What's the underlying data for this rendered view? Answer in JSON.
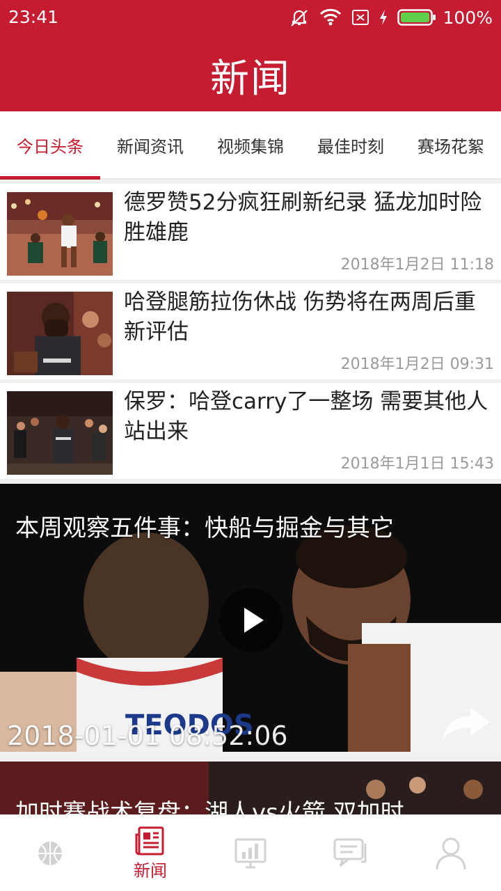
{
  "status_bar": {
    "time": "23:41",
    "battery": "100%",
    "icons": [
      "mute-icon",
      "wifi-icon",
      "sim-off-icon",
      "charging-icon",
      "battery-icon"
    ]
  },
  "header": {
    "title": "新闻"
  },
  "tabs": [
    {
      "label": "今日头条",
      "active": true
    },
    {
      "label": "新闻资讯",
      "active": false
    },
    {
      "label": "视频集锦",
      "active": false
    },
    {
      "label": "最佳时刻",
      "active": false
    },
    {
      "label": "赛场花絮",
      "active": false
    }
  ],
  "news": [
    {
      "title": "德罗赞52分疯狂刷新纪录 猛龙加时险胜雄鹿",
      "time": "2018年1月2日 11:18"
    },
    {
      "title": "哈登腿筋拉伤休战 伤势将在两周后重新评估",
      "time": "2018年1月2日 09:31"
    },
    {
      "title": "保罗：哈登carry了一整场 需要其他人站出来",
      "time": "2018年1月1日 15:43"
    }
  ],
  "videos": [
    {
      "title": "本周观察五件事：快船与掘金与其它",
      "time": "2018-01-01 08:52:06"
    },
    {
      "title": "加时赛战术复盘：湖人vs火箭 双加时"
    }
  ],
  "bottom_nav": [
    {
      "icon": "basketball-icon",
      "label": ""
    },
    {
      "icon": "newspaper-icon",
      "label": "新闻",
      "active": true
    },
    {
      "icon": "stats-chart-icon",
      "label": ""
    },
    {
      "icon": "chat-icon",
      "label": ""
    },
    {
      "icon": "user-icon",
      "label": ""
    }
  ],
  "colors": {
    "brand": "#c51c32",
    "inactive_icon": "#cfcfcf",
    "time_text": "#9a9a9a"
  }
}
